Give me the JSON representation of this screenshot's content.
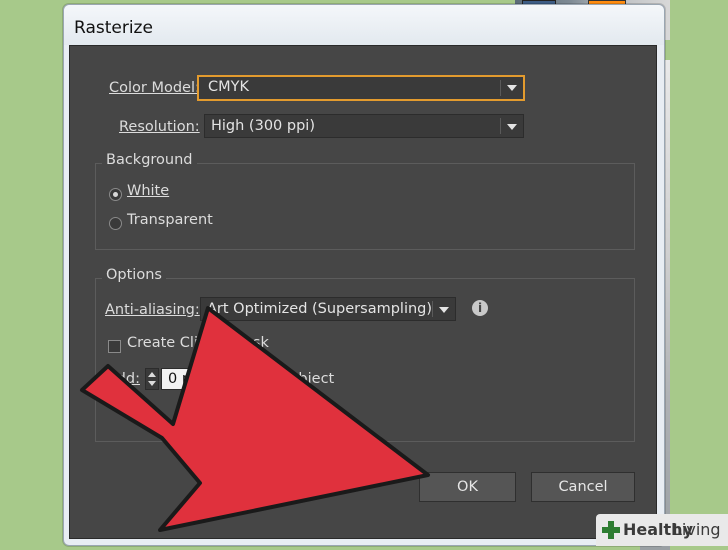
{
  "dialog": {
    "title": "Rasterize",
    "color_model": {
      "label": "Color Model:",
      "value": "CMYK"
    },
    "resolution": {
      "label": "Resolution:",
      "value": "High (300 ppi)"
    },
    "background": {
      "group_label": "Background",
      "options": [
        {
          "label": "White",
          "selected": true
        },
        {
          "label": "Transparent",
          "selected": false
        }
      ]
    },
    "options": {
      "group_label": "Options",
      "anti_aliasing": {
        "label": "Anti-aliasing:",
        "value": "Art Optimized (Supersampling)"
      },
      "clipping_mask_label": "Create Clip",
      "clipping_mask_label_tail": "ask",
      "add": {
        "label": "Add:",
        "value": "0 pt",
        "tail": "Object"
      }
    },
    "buttons": {
      "ok": "OK",
      "cancel": "Cancel"
    }
  },
  "watermark": {
    "brand_bold": "Healthy",
    "brand_regular": "Living"
  },
  "colors": {
    "arrow": "#e0313d",
    "panel": "#464646",
    "focus": "#e39b2e",
    "brand_green": "#2e7d32"
  },
  "icons": [
    "info-icon",
    "chevron-down-icon",
    "stepper-icon",
    "healthy-living-plus-icon",
    "pointing-arrow"
  ]
}
